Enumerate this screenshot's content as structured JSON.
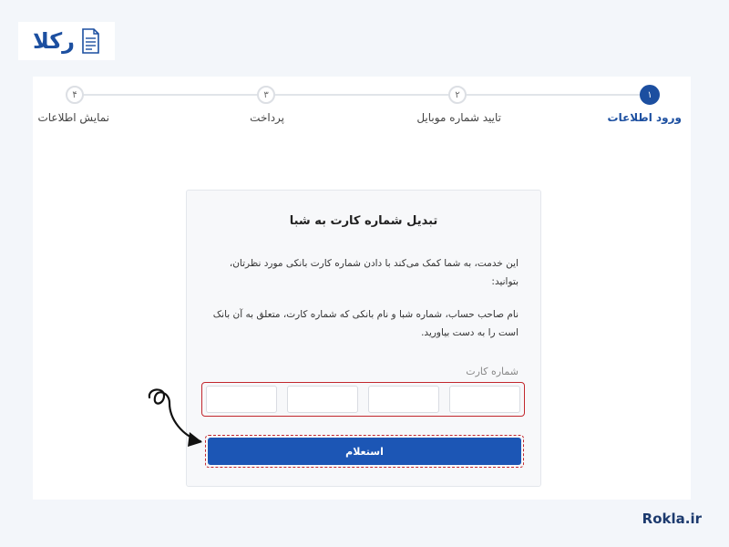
{
  "brand": {
    "logo_text": "رکلا",
    "footer_text": "Rokla.ir",
    "accent_color": "#1c4fa0",
    "highlight_color": "#c2272d"
  },
  "steps": [
    {
      "number": "۱",
      "label": "ورود اطلاعات",
      "active": true
    },
    {
      "number": "۲",
      "label": "تایید شماره موبایل",
      "active": false
    },
    {
      "number": "۳",
      "label": "پرداخت",
      "active": false
    },
    {
      "number": "۴",
      "label": "نمایش اطلاعات",
      "active": false
    }
  ],
  "form": {
    "title": "تبدیل شماره کارت به شبا",
    "description_1": "این خدمت، به شما کمک می‌کند با دادن شماره کارت بانکی مورد نظرتان، بتوانید:",
    "description_2": "نام صاحب حساب، شماره شبا و نام بانکی که شماره کارت، متعلق به آن بانک است را به دست بیاورید.",
    "card_number_label": "شماره کارت",
    "card_segments": [
      "",
      "",
      "",
      ""
    ],
    "submit_label": "استعلام"
  },
  "icons": {
    "logo": "document-icon",
    "arrow": "hand-drawn-arrow-icon"
  }
}
